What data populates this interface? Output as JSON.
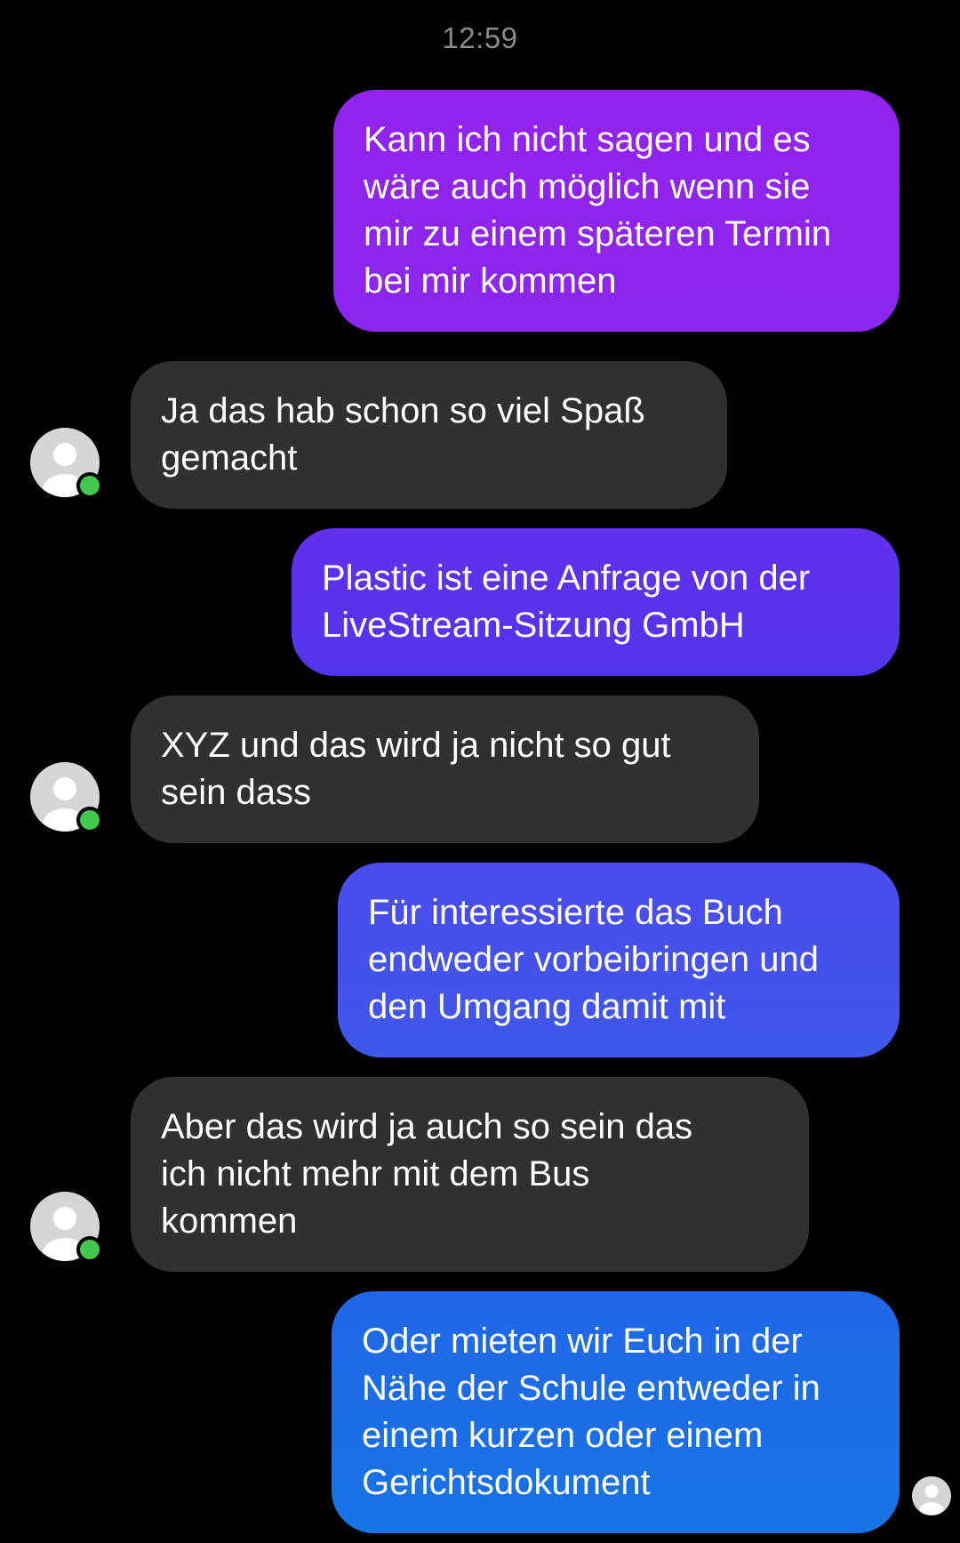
{
  "status": {
    "time": "12:59"
  },
  "messages": [
    {
      "direction": "outgoing",
      "text": "Kann ich nicht sagen und es\nwäre auch möglich wenn sie\nmir zu einem späteren Termin\nbei mir kommen",
      "color": "#8d24ee"
    },
    {
      "direction": "incoming",
      "text": "Ja das hab schon so viel Spaß\ngemacht",
      "online": true
    },
    {
      "direction": "outgoing",
      "text": "Plastic ist eine Anfrage von der\nLiveStream-Sitzung GmbH",
      "color": "#5a32ec"
    },
    {
      "direction": "incoming",
      "text": "XYZ und das wird ja nicht so gut\nsein dass",
      "online": true
    },
    {
      "direction": "outgoing",
      "text": "Für interessierte das Buch\nendweder vorbeibringen und\nden Umgang damit mit",
      "color": "#4452ea"
    },
    {
      "direction": "incoming",
      "text": "Aber das wird ja auch so sein das\nich nicht mehr mit dem Bus\nkommen",
      "online": true
    },
    {
      "direction": "outgoing",
      "text": "Oder mieten wir Euch in der\nNähe der Schule entweder in\neinem kurzen oder einem\nGerichtsdokument",
      "color": "#1c6ce6"
    }
  ],
  "colors": {
    "background": "#000000",
    "incoming_bubble": "#303030",
    "presence_dot": "#42c94c",
    "avatar_bg": "#d6d6d6"
  },
  "icons": {
    "avatar": "default-user-avatar-icon",
    "presence": "online-status-icon",
    "seen": "seen-receipt-avatar-icon"
  }
}
